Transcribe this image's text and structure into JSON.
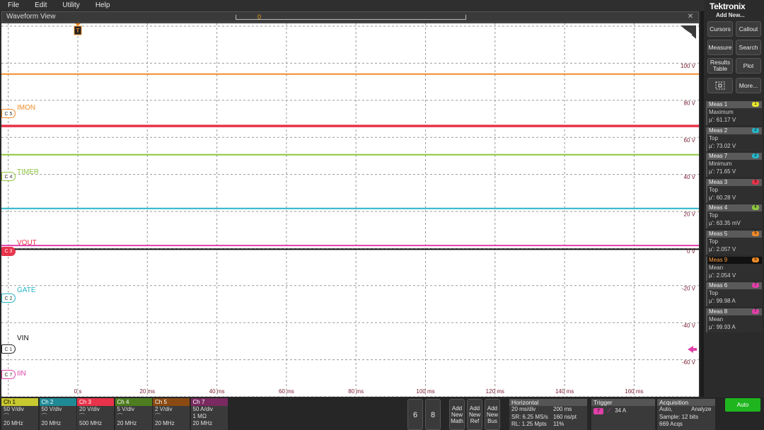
{
  "menu": [
    "File",
    "Edit",
    "Utility",
    "Help"
  ],
  "window": {
    "title": "Waveform View",
    "record_marker": "0",
    "close": "✕"
  },
  "brand": "Tektronix",
  "right_panel": {
    "add_new": "Add New...",
    "buttons": {
      "cursors": "Cursors",
      "callout": "Callout",
      "measure": "Measure",
      "search": "Search",
      "results_table": "Results Table",
      "plot": "Plot",
      "more": "More..."
    }
  },
  "trigger_marker": "T",
  "channels": [
    {
      "id": "C5",
      "badge": "C 5",
      "label": "IMON",
      "color": "#f28c28"
    },
    {
      "id": "C4",
      "badge": "C 4",
      "label": "TIMER",
      "color": "#8dc63f"
    },
    {
      "id": "C3",
      "badge": "C 3",
      "label": "VOUT",
      "color": "#e8334a"
    },
    {
      "id": "C2",
      "badge": "C 2",
      "label": "GATE",
      "color": "#27b6c8"
    },
    {
      "id": "C1",
      "badge": "C 1",
      "label": "VIN",
      "color": "#222222"
    },
    {
      "id": "C7",
      "badge": "C 7",
      "label": "IIN",
      "color": "#e040a8"
    }
  ],
  "chart_data": {
    "type": "line",
    "x_ticks": [
      "0 s",
      "20 ms",
      "40 ms",
      "60 ms",
      "80 ms",
      "100 ms",
      "120 ms",
      "140 ms",
      "160 ms"
    ],
    "y_ticks": [
      "100 V",
      "80 V",
      "60 V",
      "40 V",
      "20 V",
      "0 V",
      "-20 V",
      "-40 V",
      "-60 V"
    ],
    "ylim": [
      -60,
      100
    ],
    "grid": true,
    "series": [
      {
        "name": "IMON",
        "color": "#f28c28",
        "level": 95.5,
        "width": 2
      },
      {
        "name": "VOUT",
        "color": "#e8334a",
        "level": 67.5,
        "width": 3.5
      },
      {
        "name": "TIMER",
        "color": "#8dc63f",
        "level": 52,
        "width": 2
      },
      {
        "name": "GATE",
        "color": "#27b6c8",
        "level": 23,
        "width": 2
      },
      {
        "name": "IIN",
        "color": "#e040a8",
        "level": 3,
        "width": 2
      },
      {
        "name": "VIN",
        "color": "#111111",
        "level": 1,
        "width": 2
      }
    ]
  },
  "measurements": [
    {
      "title": "Meas 1",
      "chip": "1",
      "chip_color": "#e8e830",
      "type": "Maximum",
      "value": "µ': 61.17 V",
      "active": false
    },
    {
      "title": "Meas 2",
      "chip": "2",
      "chip_color": "#27b6c8",
      "type": "Top",
      "value": "µ': 73.02 V",
      "active": false
    },
    {
      "title": "Meas 7",
      "chip": "2",
      "chip_color": "#27b6c8",
      "type": "Minimum",
      "value": "µ': 71.65 V",
      "active": false
    },
    {
      "title": "Meas 3",
      "chip": "3",
      "chip_color": "#e8334a",
      "type": "Top",
      "value": "µ': 60.28 V",
      "active": false
    },
    {
      "title": "Meas 4",
      "chip": "4",
      "chip_color": "#8dc63f",
      "type": "Top",
      "value": "µ': 63.35 mV",
      "active": false
    },
    {
      "title": "Meas 5",
      "chip": "5",
      "chip_color": "#f28c28",
      "type": "Top",
      "value": "µ': 2.057 V",
      "active": false
    },
    {
      "title": "Meas 9",
      "chip": "5",
      "chip_color": "#f28c28",
      "type": "Mean",
      "value": "µ': 2.054 V",
      "active": true
    },
    {
      "title": "Meas 6",
      "chip": "7",
      "chip_color": "#e040a8",
      "type": "Top",
      "value": "µ': 99.98 A",
      "active": false
    },
    {
      "title": "Meas 8",
      "chip": "7",
      "chip_color": "#e040a8",
      "type": "Mean",
      "value": "µ': 99.93 A",
      "active": false
    }
  ],
  "channel_boxes": [
    {
      "name": "Ch 1",
      "color": "#c8c830",
      "head_text": "#000000",
      "scale": "50 V/div",
      "bw": "20 MHz"
    },
    {
      "name": "Ch 2",
      "color": "#1f8a96",
      "head_text": "#ffffff",
      "scale": "50 V/div",
      "bw": "20 MHz"
    },
    {
      "name": "Ch 3",
      "color": "#e8334a",
      "head_text": "#ffffff",
      "scale": "20 V/div",
      "bw": "500 MHz"
    },
    {
      "name": "Ch 4",
      "color": "#4e7d1f",
      "head_text": "#ffffff",
      "scale": "5 V/div",
      "bw": "20 MHz"
    },
    {
      "name": "Ch 5",
      "color": "#8a4a12",
      "head_text": "#ffffff",
      "scale": "2 V/div",
      "bw": "20 MHz"
    },
    {
      "name": "Ch 7",
      "color": "#7a2a60",
      "head_text": "#ffffff",
      "scale": "50 A/div",
      "extra": "1 MΩ",
      "bw": "20 MHz"
    }
  ],
  "bottom_buttons": {
    "num6": "6",
    "num8": "8",
    "add_math": "Add New Math",
    "add_ref": "Add New Ref",
    "add_bus": "Add New Bus"
  },
  "horizontal": {
    "title": "Horizontal",
    "row1_l": "20 ms/div",
    "row1_r": "200 ms",
    "row2_l": "SR: 6.25 MS/s",
    "row2_r": "160 ns/pt",
    "row3_l": "RL: 1.25 Mpts",
    "row3_r": "11%"
  },
  "trigger": {
    "title": "Trigger",
    "chip": "7",
    "level": "34 A"
  },
  "acquisition": {
    "title": "Acquisition",
    "mode": "Auto,",
    "analyze": "Analyze",
    "sample": "Sample: 12 bits",
    "acqs": "669 Acqs"
  },
  "auto_button": "Auto"
}
